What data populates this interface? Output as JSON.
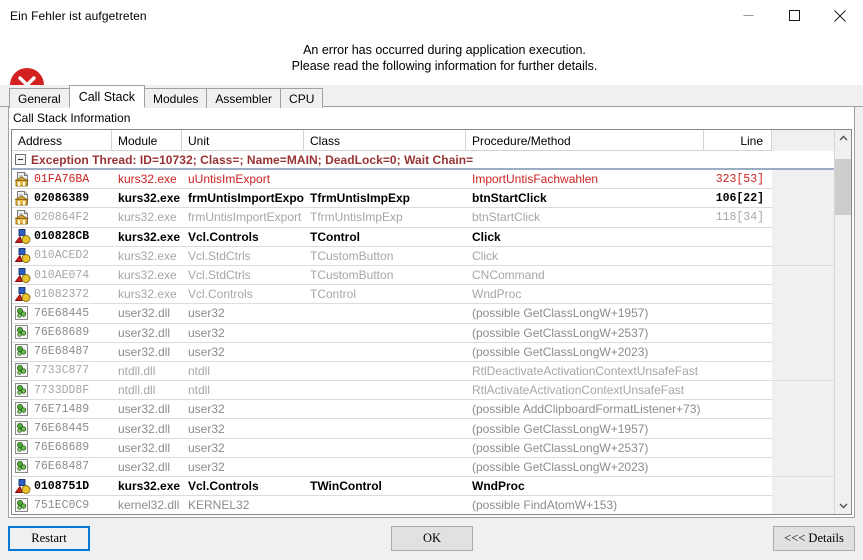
{
  "window": {
    "title": "Ein Fehler ist aufgetreten",
    "minimize_label": "Minimize",
    "maximize_label": "Maximize",
    "close_label": "Close"
  },
  "banner": {
    "line1": "An error has occurred during application execution.",
    "line2": "Please read the following information for further details.",
    "icon": "error-circle-x-icon",
    "icon_color": "#d32020"
  },
  "tabs": [
    {
      "label": "General",
      "active": false
    },
    {
      "label": "Call Stack",
      "active": true
    },
    {
      "label": "Modules",
      "active": false
    },
    {
      "label": "Assembler",
      "active": false
    },
    {
      "label": "CPU",
      "active": false
    }
  ],
  "page": {
    "caption": "Call Stack Information"
  },
  "grid": {
    "columns": [
      "Address",
      "Module",
      "Unit",
      "Class",
      "Procedure/Method",
      "Line"
    ],
    "thread_header": "Exception Thread: ID=10732; Class=; Name=MAIN; DeadLock=0; Wait Chain=",
    "rows": [
      {
        "icon": "source-file-icon",
        "address": "01FA76BA",
        "module": "kurs32.exe",
        "unit": "uUntisImExport",
        "class": "",
        "procedure": "ImportUntisFachwahlen",
        "line": "323[53]",
        "tone": "t-red"
      },
      {
        "icon": "source-file-icon",
        "address": "02086389",
        "module": "kurs32.exe",
        "unit": "frmUntisImportExport",
        "class": "TfrmUntisImpExp",
        "procedure": "btnStartClick",
        "line": "106[22]",
        "tone": "t-black"
      },
      {
        "icon": "source-file-icon",
        "address": "020864F2",
        "module": "kurs32.exe",
        "unit": "frmUntisImportExport",
        "class": "TfrmUntisImpExp",
        "procedure": "btnStartClick",
        "line": "118[34]",
        "tone": "t-gray"
      },
      {
        "icon": "vcl-package-icon",
        "address": "010828CB",
        "module": "kurs32.exe",
        "unit": "Vcl.Controls",
        "class": "TControl",
        "procedure": "Click",
        "line": "",
        "tone": "t-black"
      },
      {
        "icon": "vcl-package-icon",
        "address": "010ACED2",
        "module": "kurs32.exe",
        "unit": "Vcl.StdCtrls",
        "class": "TCustomButton",
        "procedure": "Click",
        "line": "",
        "tone": "t-gray"
      },
      {
        "icon": "vcl-package-icon",
        "address": "010AE074",
        "module": "kurs32.exe",
        "unit": "Vcl.StdCtrls",
        "class": "TCustomButton",
        "procedure": "CNCommand",
        "line": "",
        "tone": "t-gray"
      },
      {
        "icon": "vcl-package-icon",
        "address": "01082372",
        "module": "kurs32.exe",
        "unit": "Vcl.Controls",
        "class": "TControl",
        "procedure": "WndProc",
        "line": "",
        "tone": "t-gray"
      },
      {
        "icon": "dll-module-icon",
        "address": "76E68445",
        "module": "user32.dll",
        "unit": "user32",
        "class": "",
        "procedure": "(possible GetClassLongW+1957)",
        "line": "",
        "tone": "t-dim"
      },
      {
        "icon": "dll-module-icon",
        "address": "76E68689",
        "module": "user32.dll",
        "unit": "user32",
        "class": "",
        "procedure": "(possible GetClassLongW+2537)",
        "line": "",
        "tone": "t-dim"
      },
      {
        "icon": "dll-module-icon",
        "address": "76E68487",
        "module": "user32.dll",
        "unit": "user32",
        "class": "",
        "procedure": "(possible GetClassLongW+2023)",
        "line": "",
        "tone": "t-dim"
      },
      {
        "icon": "dll-module-icon",
        "address": "7733C877",
        "module": "ntdll.dll",
        "unit": "ntdll",
        "class": "",
        "procedure": "RtlDeactivateActivationContextUnsafeFast",
        "line": "",
        "tone": "t-gray"
      },
      {
        "icon": "dll-module-icon",
        "address": "7733DD8F",
        "module": "ntdll.dll",
        "unit": "ntdll",
        "class": "",
        "procedure": "RtlActivateActivationContextUnsafeFast",
        "line": "",
        "tone": "t-gray"
      },
      {
        "icon": "dll-module-icon",
        "address": "76E71489",
        "module": "user32.dll",
        "unit": "user32",
        "class": "",
        "procedure": "(possible AddClipboardFormatListener+73)",
        "line": "",
        "tone": "t-dim"
      },
      {
        "icon": "dll-module-icon",
        "address": "76E68445",
        "module": "user32.dll",
        "unit": "user32",
        "class": "",
        "procedure": "(possible GetClassLongW+1957)",
        "line": "",
        "tone": "t-dim"
      },
      {
        "icon": "dll-module-icon",
        "address": "76E68689",
        "module": "user32.dll",
        "unit": "user32",
        "class": "",
        "procedure": "(possible GetClassLongW+2537)",
        "line": "",
        "tone": "t-dim"
      },
      {
        "icon": "dll-module-icon",
        "address": "76E68487",
        "module": "user32.dll",
        "unit": "user32",
        "class": "",
        "procedure": "(possible GetClassLongW+2023)",
        "line": "",
        "tone": "t-dim"
      },
      {
        "icon": "vcl-package-icon",
        "address": "0108751D",
        "module": "kurs32.exe",
        "unit": "Vcl.Controls",
        "class": "TWinControl",
        "procedure": "WndProc",
        "line": "",
        "tone": "t-black"
      },
      {
        "icon": "dll-module-icon",
        "address": "751EC0C9",
        "module": "kernel32.dll",
        "unit": "KERNEL32",
        "class": "",
        "procedure": "(possible FindAtomW+153)",
        "line": "",
        "tone": "t-dim"
      }
    ]
  },
  "footer": {
    "restart_label": "Restart",
    "ok_label": "OK",
    "details_label": "<<< Details"
  }
}
